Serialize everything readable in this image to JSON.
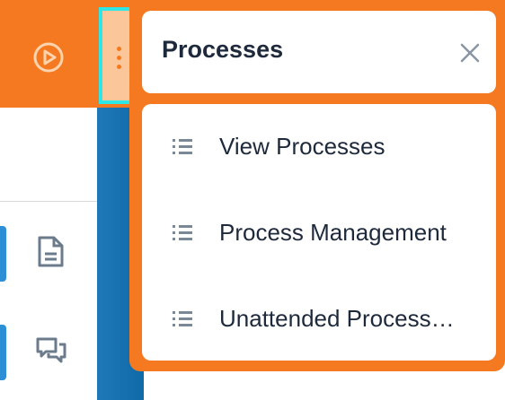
{
  "sidebar": {
    "icons": [
      "play-circle-icon",
      "document-icon",
      "chat-icon"
    ]
  },
  "popover": {
    "title": "Processes",
    "items": [
      {
        "label": "View Processes",
        "icon": "list-icon"
      },
      {
        "label": "Process Management",
        "icon": "list-icon"
      },
      {
        "label": "Unattended Process…",
        "icon": "list-icon"
      }
    ]
  },
  "colors": {
    "accent": "#f47920",
    "sidebar_blue": "#1f78b8",
    "highlight": "#2ee6e6",
    "text": "#1e2a3b"
  }
}
